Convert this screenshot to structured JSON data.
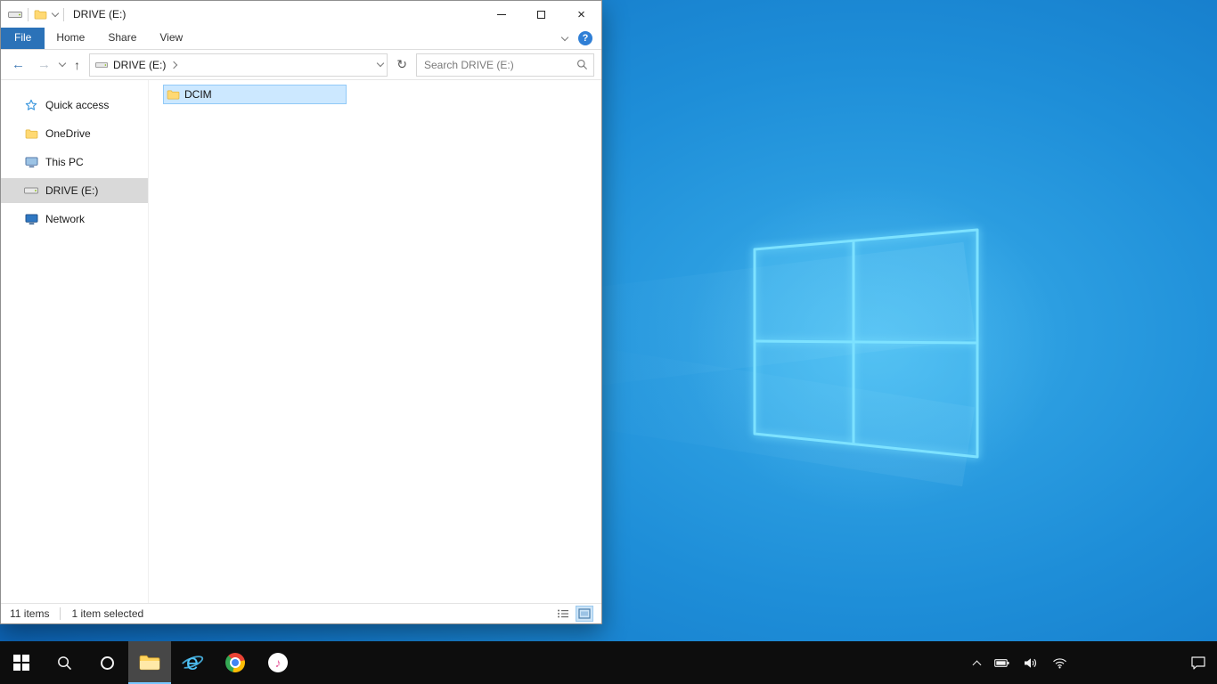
{
  "colors": {
    "file_tab_blue": "#2b72b8",
    "selection_fill": "#cce8ff",
    "selection_border": "#91c9f7",
    "sidebar_selected_gray": "#d9d9d9",
    "taskbar_black": "#0d0d0d",
    "wallpaper_center_blue": "#38ace9",
    "wallpaper_edge_blue": "#09509c",
    "folder_yellow": "#ffd973",
    "taskbar_active_underline": "#76c7ff"
  },
  "window": {
    "title": "DRIVE (E:)",
    "controls": {
      "close": "×"
    }
  },
  "ribbon": {
    "tabs": [
      {
        "label": "File",
        "active": true
      },
      {
        "label": "Home",
        "active": false
      },
      {
        "label": "Share",
        "active": false
      },
      {
        "label": "View",
        "active": false
      }
    ],
    "help_label": "?"
  },
  "navbar": {
    "back": "←",
    "forward": "→",
    "up": "↑",
    "refresh": "↻",
    "breadcrumb_root": "DRIVE (E:)",
    "search_placeholder": "Search DRIVE (E:)"
  },
  "sidebar": {
    "items": [
      {
        "label": "Quick access",
        "icon": "star-icon",
        "selected": false
      },
      {
        "label": "OneDrive",
        "icon": "folder-icon",
        "selected": false
      },
      {
        "label": "This PC",
        "icon": "computer-icon",
        "selected": false
      },
      {
        "label": "DRIVE (E:)",
        "icon": "drive-icon",
        "selected": true
      },
      {
        "label": "Network",
        "icon": "network-icon",
        "selected": false
      }
    ]
  },
  "files": {
    "items": [
      {
        "name": "DCIM",
        "icon": "folder-icon",
        "selected": true
      }
    ]
  },
  "statusbar": {
    "count": "11 items",
    "selected": "1 item selected"
  },
  "taskbar": {
    "buttons": [
      {
        "name": "start",
        "icon": "windows-logo-icon"
      },
      {
        "name": "search",
        "icon": "search-icon"
      },
      {
        "name": "cortana",
        "icon": "cortana-icon"
      },
      {
        "name": "file-explorer",
        "icon": "folder-icon",
        "active": true
      },
      {
        "name": "internet-explorer",
        "icon": "ie-icon"
      },
      {
        "name": "chrome",
        "icon": "chrome-icon"
      },
      {
        "name": "itunes",
        "icon": "itunes-icon",
        "note_glyph": "♪"
      }
    ],
    "tray": [
      {
        "name": "show-hidden-icons",
        "icon": "chevron-up-icon"
      },
      {
        "name": "battery",
        "icon": "battery-icon"
      },
      {
        "name": "volume",
        "icon": "speaker-icon"
      },
      {
        "name": "network",
        "icon": "wifi-icon"
      },
      {
        "name": "action-center",
        "icon": "action-center-icon"
      }
    ]
  }
}
